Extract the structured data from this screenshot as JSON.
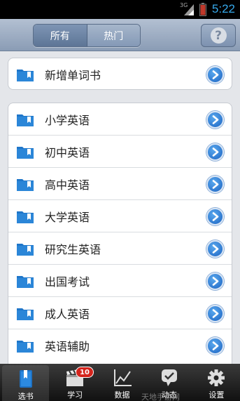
{
  "status_bar": {
    "network": "3G",
    "time": "5:22"
  },
  "nav": {
    "segments": [
      "所有",
      "热门"
    ],
    "active_segment": 0,
    "help_label": "?"
  },
  "top_group": {
    "items": [
      {
        "label": "新增单词书"
      }
    ]
  },
  "book_list": {
    "items": [
      {
        "label": "小学英语"
      },
      {
        "label": "初中英语"
      },
      {
        "label": "高中英语"
      },
      {
        "label": "大学英语"
      },
      {
        "label": "研究生英语"
      },
      {
        "label": "出国考试"
      },
      {
        "label": "成人英语"
      },
      {
        "label": "英语辅助"
      }
    ]
  },
  "tabbar": {
    "tabs": [
      {
        "label": "选书",
        "icon": "book-icon",
        "active": true
      },
      {
        "label": "学习",
        "icon": "clapper-icon",
        "badge": "10"
      },
      {
        "label": "数据",
        "icon": "chart-icon"
      },
      {
        "label": "动态",
        "icon": "chat-check-icon"
      },
      {
        "label": "设置",
        "icon": "gear-icon"
      }
    ]
  },
  "watermark": "天地手游网",
  "colors": {
    "accent_blue": "#1b63c2",
    "folder_blue": "#1f76c9",
    "badge_red": "#d4241c",
    "time_blue": "#36a8ea"
  }
}
